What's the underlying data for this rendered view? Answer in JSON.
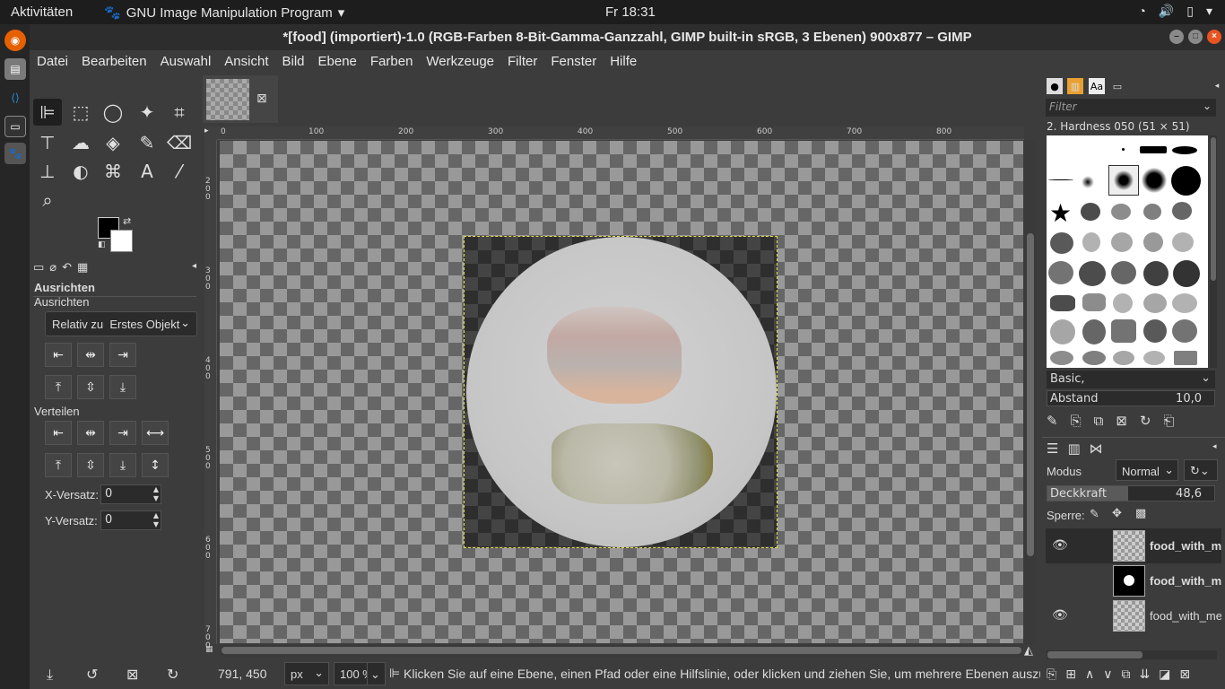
{
  "topbar": {
    "activities": "Aktivitäten",
    "app_name": "GNU Image Manipulation Program",
    "clock": "Fr 18:31"
  },
  "window": {
    "title": "*[food] (importiert)-1.0 (RGB-Farben 8-Bit-Gamma-Ganzzahl, GIMP built-in sRGB, 3 Ebenen) 900x877 – GIMP"
  },
  "menu": [
    "Datei",
    "Bearbeiten",
    "Auswahl",
    "Ansicht",
    "Bild",
    "Ebene",
    "Farben",
    "Werkzeuge",
    "Filter",
    "Fenster",
    "Hilfe"
  ],
  "tool_options": {
    "title": "Ausrichten",
    "subtitle": "Ausrichten",
    "relative_label": "Relativ zu",
    "relative_value": "Erstes Objekt",
    "distribute_label": "Verteilen",
    "x_offset_label": "X-Versatz:",
    "x_offset_value": "0",
    "y_offset_label": "Y-Versatz:",
    "y_offset_value": "0"
  },
  "ruler": {
    "top": [
      "0",
      "100",
      "200",
      "300",
      "400",
      "500",
      "600",
      "700",
      "800"
    ],
    "left": [
      "2 0 0",
      "3 0 0",
      "4 0 0",
      "5 0 0",
      "6 0 0",
      "7 0 0"
    ]
  },
  "status": {
    "coords": "791, 450",
    "unit": "px",
    "zoom": "100 %",
    "message": "Klicken Sie auf eine Ebene, einen Pfad oder eine Hilfslinie, oder klicken und ziehen Sie, um mehrere Ebenen auszuwählen"
  },
  "brushes": {
    "filter_placeholder": "Filter",
    "selected": "2. Hardness 050 (51 × 51)",
    "preset": "Basic,",
    "spacing_label": "Abstand",
    "spacing_value": "10,0"
  },
  "layers": {
    "mode_label": "Modus",
    "mode_value": "Normal",
    "opacity_label": "Deckkraft",
    "opacity_value": "48,6",
    "opacity_fraction": 0.486,
    "lock_label": "Sperre:",
    "items": [
      {
        "name": "food_with_me",
        "visible": true
      },
      {
        "name": "food_with_me",
        "visible": false
      },
      {
        "name": "food_with_me",
        "visible": true
      }
    ]
  }
}
